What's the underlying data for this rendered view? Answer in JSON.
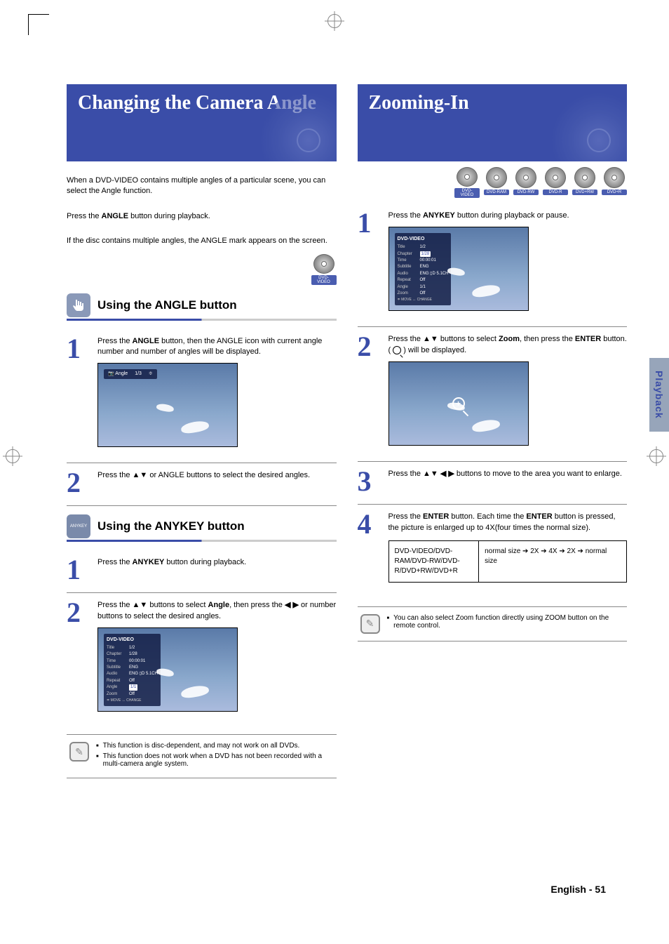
{
  "side_tab": "Playback",
  "footer": {
    "label": "English",
    "page": "- 51"
  },
  "left": {
    "title": "Changing the Camera Angle",
    "intro_pre": "When a DVD-VIDEO contains multiple angles of a particular scene, you can select the Angle function.",
    "intro_press_pre": "Press the ",
    "intro_press_bold": "ANGLE",
    "intro_press_post": " button during playback.",
    "intro_note": "If the disc contains multiple angles, the ANGLE mark appears on the screen.",
    "discs": [
      "DVD-VIDEO"
    ],
    "section1": {
      "heading": "Using the ANGLE button",
      "step1_pre": "Press the ",
      "step1_bold": "ANGLE",
      "step1_post": " button, then the ANGLE icon with current angle number and number of angles will be displayed.",
      "step2_pre": "Press the ",
      "step2_bold": "▲▼",
      "step2_post": " or ANGLE buttons to select the desired angles.",
      "angle_osd_label": "Angle",
      "angle_osd_value": "1/3"
    },
    "section2": {
      "heading": "Using the ANYKEY button",
      "step1_pre": "Press the ",
      "step1_bold": "ANYKEY",
      "step1_post": " button during playback.",
      "step2_a_pre": "Press the ",
      "step2_a_bold": "▲▼",
      "step2_a_mid": " buttons to select ",
      "step2_a_bold2": "Angle",
      "step2_a_post": ", then press the ",
      "step2_b_bold": "◀ ▶",
      "step2_b_post": " or number buttons to select the desired angles."
    },
    "osd": {
      "header": "DVD-VIDEO",
      "rows": [
        {
          "k": "Title",
          "v": "1/2"
        },
        {
          "k": "Chapter",
          "v": "1/28"
        },
        {
          "k": "Time",
          "v": "00:00:01"
        },
        {
          "k": "Subtitle",
          "v": "ENG"
        },
        {
          "k": "Audio",
          "v": "ENG ▯D 5.1CH"
        },
        {
          "k": "Repeat",
          "v": "Off"
        },
        {
          "k": "Angle",
          "v": "1/1"
        },
        {
          "k": "Zoom",
          "v": "Off"
        }
      ],
      "active_index": 6,
      "legend": "≑ MOVE   ↔ CHANGE"
    },
    "notes": [
      "This function is disc-dependent, and may not work on all DVDs.",
      "This function does not work when a DVD has not been recorded with a multi-camera angle system."
    ]
  },
  "right": {
    "title": "Zooming-In",
    "discs": [
      "DVD-VIDEO",
      "DVD-RAM",
      "DVD-RW",
      "DVD-R",
      "DVD+RW",
      "DVD+R"
    ],
    "step1_pre": "Press the ",
    "step1_bold": "ANYKEY",
    "step1_post": " button during playback or pause.",
    "step2_a_pre": "Press the ",
    "step2_a_bold": "▲▼",
    "step2_a_mid": " buttons to select ",
    "step2_a_bold2": "Zoom",
    "step2_a_post": ", then press the ",
    "step2_b_bold": "ENTER",
    "step2_b_post": " button. ( ",
    "step2_b_after": " ) will be displayed.",
    "step3_pre": "Press the ",
    "step3_bold": "▲▼ ◀ ▶",
    "step3_post": " buttons to move to the area you want to enlarge.",
    "step4_pre": "Press the ",
    "step4_bold": "ENTER",
    "step4_mid": " button. Each time the ",
    "step4_bold2": "ENTER",
    "step4_post": " button is pressed, the picture is enlarged up to 4X(four times the normal size).",
    "osd": {
      "header": "DVD-VIDEO",
      "rows": [
        {
          "k": "Title",
          "v": "1/2"
        },
        {
          "k": "Chapter",
          "v": "1/28"
        },
        {
          "k": "Time",
          "v": "00:00:01"
        },
        {
          "k": "Subtitle",
          "v": "ENG"
        },
        {
          "k": "Audio",
          "v": "ENG ▯D 5.1CH"
        },
        {
          "k": "Repeat",
          "v": "Off"
        },
        {
          "k": "Angle",
          "v": "1/1"
        },
        {
          "k": "Zoom",
          "v": "Off"
        }
      ],
      "active_index": 1,
      "legend": "≑ MOVE   ↔ CHANGE"
    },
    "seq_label": "DVD-VIDEO/DVD-RAM/DVD-RW/DVD-R/DVD+RW/DVD+R",
    "seq_value": "normal size ➔ 2X ➔ 4X ➔ 2X ➔ normal size",
    "note_pre": "You can also select Zoom function directly using ",
    "note_bold": "ZOOM",
    "note_post": " button on the remote control."
  }
}
